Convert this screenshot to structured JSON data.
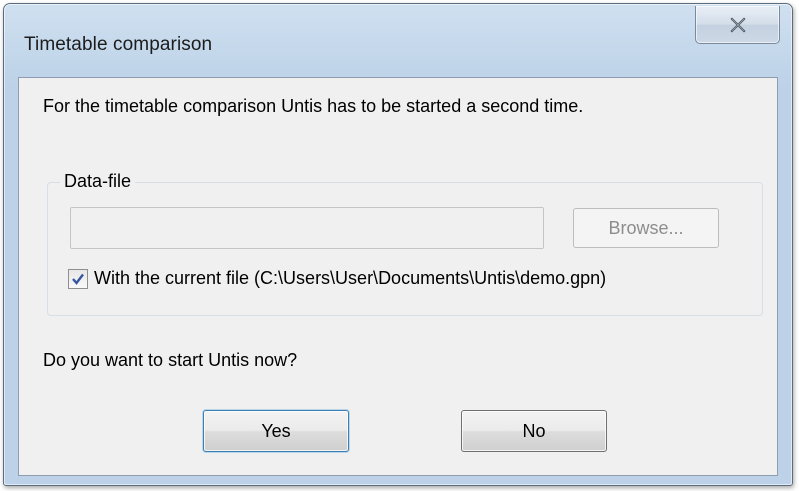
{
  "window": {
    "title": "Timetable comparison",
    "close_glyph": "⊠"
  },
  "dialog": {
    "intro_text": "For the timetable comparison Untis has to be started a second time.",
    "group": {
      "label": "Data-file",
      "file_input_value": "",
      "browse_label": "Browse...",
      "browse_enabled": false,
      "checkbox_checked": true,
      "checkbox_label": "With the current file (C:\\Users\\User\\Documents\\Untis\\demo.gpn)"
    },
    "question_text": "Do you want to start Untis now?",
    "buttons": {
      "yes_label": "Yes",
      "no_label": "No"
    }
  },
  "colors": {
    "titlebar": "#c6d9ec",
    "client_bg": "#f0f0f0",
    "default_button_border": "#3c7fb1",
    "disabled_text": "#8d8d8d"
  }
}
